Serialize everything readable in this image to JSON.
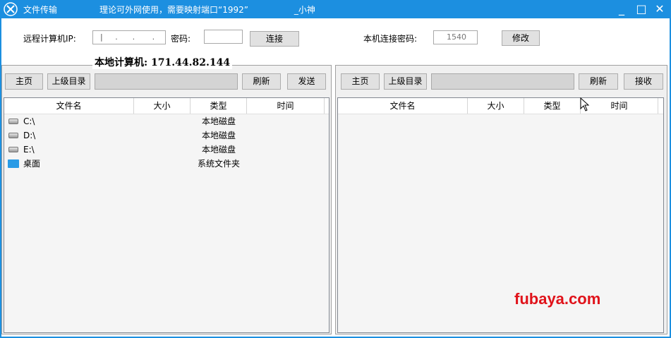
{
  "window": {
    "title": "文件传输",
    "notice": "理论可外网使用，需要映射端口“1992”                 _小神",
    "minimize_label": "_",
    "maximize_label": "□",
    "close_label": "✕",
    "accent_color": "#1c8fe0"
  },
  "connection": {
    "remote_ip_label": "远程计算机IP:",
    "remote_ip_value": "|     .      .       .",
    "password_label": "密码:",
    "password_value": "",
    "connect_label": "连接",
    "local_pass_label": "本机连接密码:",
    "local_pass_value": "1540",
    "modify_label": "修改"
  },
  "local_ip": "本地计算机: 171.44.82.144",
  "left_panel": {
    "home_label": "主页",
    "up_label": "上级目录",
    "path_value": "",
    "refresh_label": "刷新",
    "action_label": "发送",
    "columns": [
      "文件名",
      "大小",
      "类型",
      "时间"
    ],
    "rows": [
      {
        "name": "C:\\",
        "size": "",
        "type": "本地磁盘",
        "time": "",
        "icon": "drive-icon"
      },
      {
        "name": "D:\\",
        "size": "",
        "type": "本地磁盘",
        "time": "",
        "icon": "drive-icon"
      },
      {
        "name": "E:\\",
        "size": "",
        "type": "本地磁盘",
        "time": "",
        "icon": "drive-icon"
      },
      {
        "name": "桌面",
        "size": "",
        "type": "系统文件夹",
        "time": "",
        "icon": "folder-icon"
      }
    ]
  },
  "right_panel": {
    "home_label": "主页",
    "up_label": "上级目录",
    "path_value": "",
    "refresh_label": "刷新",
    "action_label": "接收",
    "columns": [
      "文件名",
      "大小",
      "类型",
      "时间"
    ]
  },
  "watermark": "fubaya.com"
}
